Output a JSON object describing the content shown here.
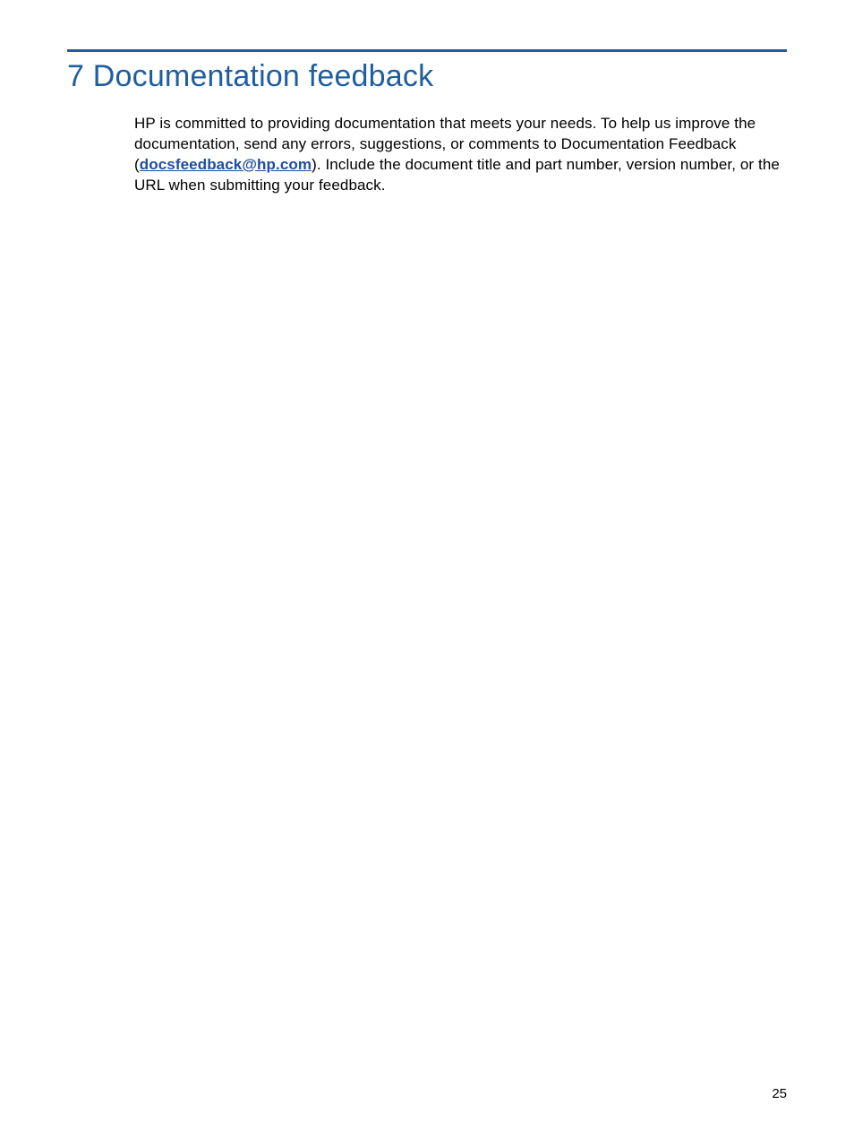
{
  "heading": "7 Documentation feedback",
  "body": {
    "part1": "HP is committed to providing documentation that meets your needs. To help us improve the documentation, send any errors, suggestions, or comments to Documentation Feedback (",
    "email": "docsfeedback@hp.com",
    "part2": "). Include the document title and part number, version number, or the URL when submitting your feedback."
  },
  "page_number": "25"
}
